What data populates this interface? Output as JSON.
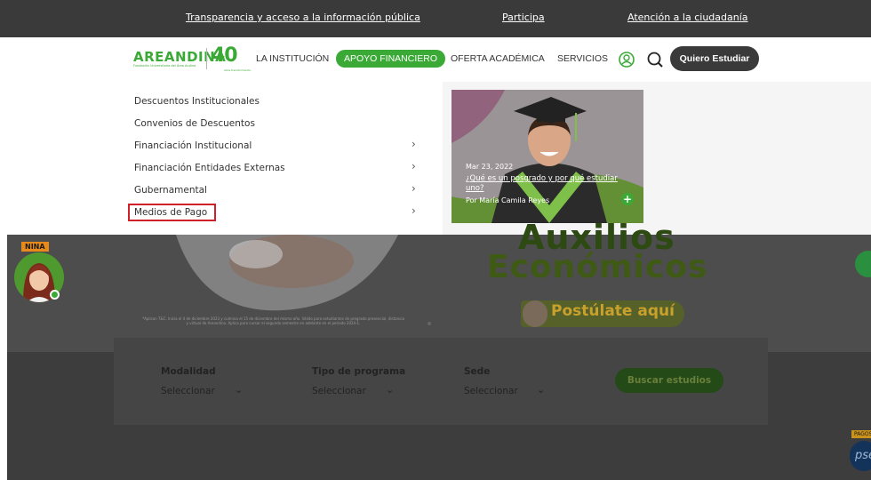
{
  "topbar": {
    "links": [
      "Transparencia y acceso a la información pública",
      "Participa",
      "Atención a la ciudadanía"
    ]
  },
  "nav": {
    "logo_text": "AREANDINA",
    "logo_sub": "Fundación Universitaria del Área Andina",
    "logo_anniv": "40",
    "logo_anniv_sub": "años transformando",
    "items": [
      "LA INSTITUCIÓN",
      "APOYO FINANCIERO",
      "OFERTA ACADÉMICA",
      "SERVICIOS"
    ],
    "active_item": "APOYO FINANCIERO",
    "cta": "Quiero Estudiar"
  },
  "dropdown": {
    "items": [
      {
        "label": "Descuentos Institucionales",
        "has_submenu": false
      },
      {
        "label": "Convenios de Descuentos",
        "has_submenu": false
      },
      {
        "label": "Financiación Institucional",
        "has_submenu": true
      },
      {
        "label": "Financiación Entidades Externas",
        "has_submenu": true
      },
      {
        "label": "Gubernamental",
        "has_submenu": true
      },
      {
        "label": "Medios de Pago",
        "has_submenu": true,
        "highlighted": true
      }
    ],
    "chevron": "›"
  },
  "news_card": {
    "date": "Mar 23, 2022",
    "title": "¿Qué es un posgrado y por qué estudiar uno?",
    "author": "Por María Camila Reyes",
    "plus": "+"
  },
  "hero": {
    "line1": "Auxilios",
    "line2": "Económicos",
    "cta": "Postúlate aquí",
    "fine_print": "*Aplican T&C. Inicia el 4 de diciembre 2023 y culmina el 15 de diciembre del mismo año. Válido para estudiantes de pregrado presencial, distancia y virtual de Areandina. Aplica para cursar el segundo semestre en adelante en el periodo 2024-1."
  },
  "assistant": {
    "badge": "NINA"
  },
  "search_form": {
    "fields": [
      {
        "label": "Modalidad",
        "value": "Seleccionar"
      },
      {
        "label": "Tipo de programa",
        "value": "Seleccionar"
      },
      {
        "label": "Sede",
        "value": "Seleccionar"
      }
    ],
    "button": "Buscar estudios",
    "select_chevron": "⌄"
  },
  "pse": {
    "tag": "PAGOS",
    "logo": "pse"
  },
  "colors": {
    "brand_green": "#3aa935",
    "dark_bar": "#3a3a3a",
    "highlight_red": "#d0202a"
  }
}
